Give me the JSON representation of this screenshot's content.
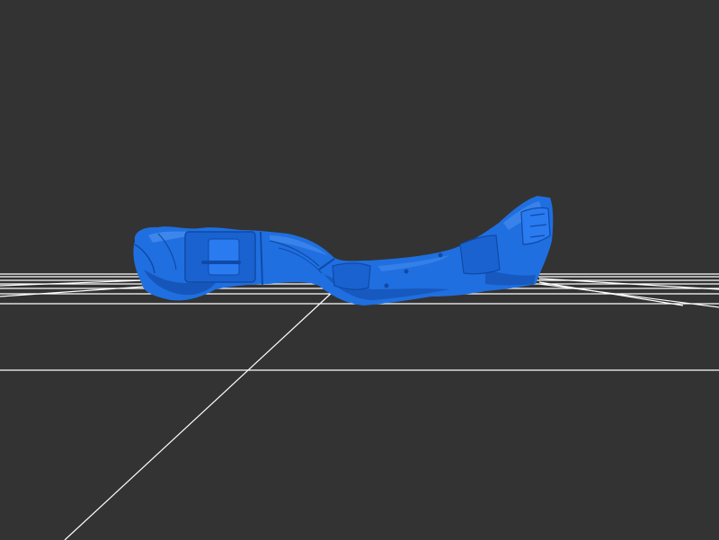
{
  "viewer": {
    "background_color": "#333333",
    "grid_color": "#ffffff",
    "model_color": "#1f6fe0",
    "model_shadow_color": "#1450b0",
    "model_highlight_color": "#4a90f0"
  },
  "model": {
    "icon": "mesh-model-icon"
  }
}
